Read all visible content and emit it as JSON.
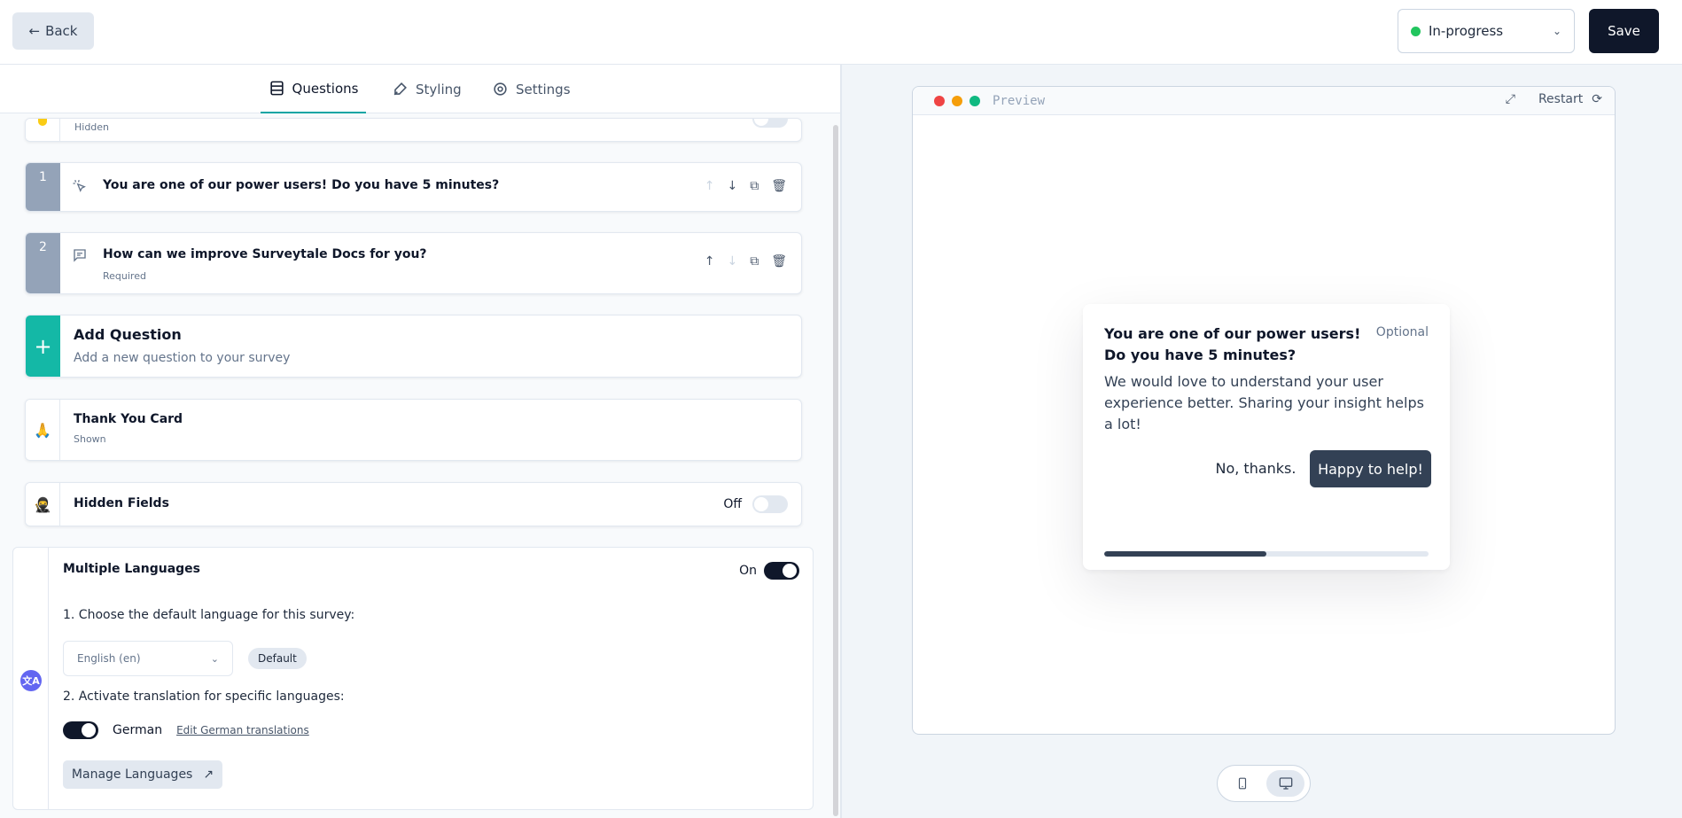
{
  "topbar": {
    "back_label": "Back",
    "status_value": "In-progress",
    "save_label": "Save"
  },
  "tabs": [
    {
      "label": "Questions",
      "icon": "list-icon"
    },
    {
      "label": "Styling",
      "icon": "paintbrush-icon"
    },
    {
      "label": "Settings",
      "icon": "gear-icon"
    }
  ],
  "welcome_card": {
    "subtitle": "Hidden"
  },
  "questions": [
    {
      "number": "1",
      "icon": "cursor-click-icon",
      "title": "You are one of our power users! Do you have 5 minutes?",
      "subtitle": ""
    },
    {
      "number": "2",
      "icon": "message-icon",
      "title": "How can we improve  Surveytale Docs for you?",
      "subtitle": "Required"
    }
  ],
  "add_question": {
    "title": "Add Question",
    "subtitle": "Add a new question to your survey"
  },
  "thank_you": {
    "emoji": "🙏",
    "title": "Thank You Card",
    "subtitle": "Shown"
  },
  "hidden_fields": {
    "emoji": "🥷",
    "title": "Hidden Fields",
    "toggle_label": "Off"
  },
  "languages": {
    "title": "Multiple Languages",
    "toggle_label": "On",
    "step1": "1. Choose the default language for this survey:",
    "default_language": "English (en)",
    "default_badge": "Default",
    "step2": "2. Activate translation for specific languages:",
    "german_label": "German",
    "edit_german": "Edit German translations",
    "manage_label": "Manage Languages"
  },
  "preview": {
    "label": "Preview",
    "restart_label": "Restart",
    "survey": {
      "title": "You are one of our power users! Do you have 5 minutes?",
      "optional": "Optional",
      "description": "We would love to understand your user experience better. Sharing your insight helps a lot!",
      "no_label": "No, thanks.",
      "yes_label": "Happy to help!",
      "progress": 0.5
    }
  },
  "colors": {
    "brand_teal": "#14b8a6",
    "primary_dark": "#0f172a",
    "status_green": "#22c55e"
  }
}
